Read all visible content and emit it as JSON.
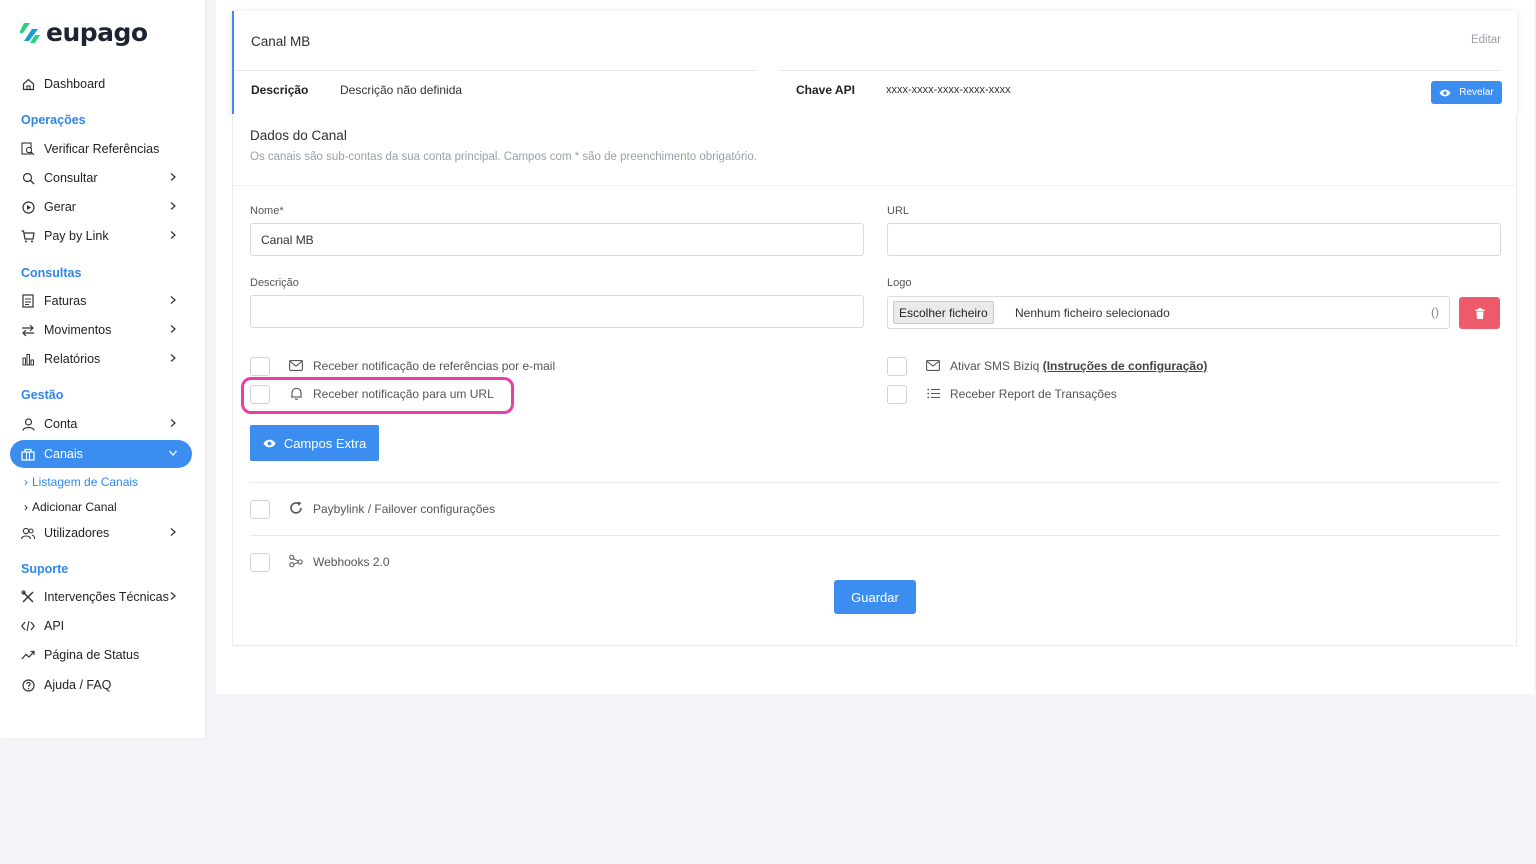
{
  "brand": {
    "name": "eupago",
    "accent": "#3b8ef0",
    "mark_colors": [
      "#2bd27a",
      "#1a9ad6"
    ]
  },
  "sidebar": {
    "dashboard": "Dashboard",
    "sections": {
      "operacoes": "Operações",
      "consultas": "Consultas",
      "gestao": "Gestão",
      "suporte": "Suporte"
    },
    "items": {
      "verificar": "Verificar Referências",
      "consultar": "Consultar",
      "gerar": "Gerar",
      "paybylink": "Pay by Link",
      "faturas": "Faturas",
      "movimentos": "Movimentos",
      "relatorios": "Relatórios",
      "conta": "Conta",
      "canais": "Canais",
      "listagem": "Listagem de Canais",
      "adicionar": "Adicionar Canal",
      "utilizadores": "Utilizadores",
      "intervencoes": "Intervenções Técnicas",
      "api": "API",
      "status": "Página de Status",
      "ajuda": "Ajuda / FAQ"
    }
  },
  "channel": {
    "title": "Canal MB",
    "edit": "Editar",
    "desc_label": "Descrição",
    "desc_value": "Descrição não definida",
    "api_label": "Chave API",
    "api_value": "xxxx-xxxx-xxxx-xxxx-xxxx",
    "reveal": "Revelar"
  },
  "form": {
    "title": "Dados do Canal",
    "subtitle": "Os canais são sub-contas da sua conta principal. Campos com *  são de preenchimento obrigatório.",
    "name_label": "Nome*",
    "name_value": "Canal MB",
    "url_label": "URL",
    "url_value": "",
    "desc_label": "Descrição",
    "desc_value": "",
    "logo_label": "Logo",
    "file_button": "Escolher ficheiro",
    "file_status": "Nenhum ficheiro selecionado",
    "file_paren": "()",
    "cb_email": "Receber notificação de referências por e-mail",
    "cb_url": "Receber notificação para um URL",
    "cb_sms": "Ativar SMS Biziq ",
    "cb_sms_link": "(Instruções de configuração)",
    "cb_report": "Receber Report de Transações",
    "extra_button": "Campos Extra",
    "cb_failover": "Paybylink / Failover configurações",
    "cb_webhooks": "Webhooks 2.0",
    "save": "Guardar"
  }
}
